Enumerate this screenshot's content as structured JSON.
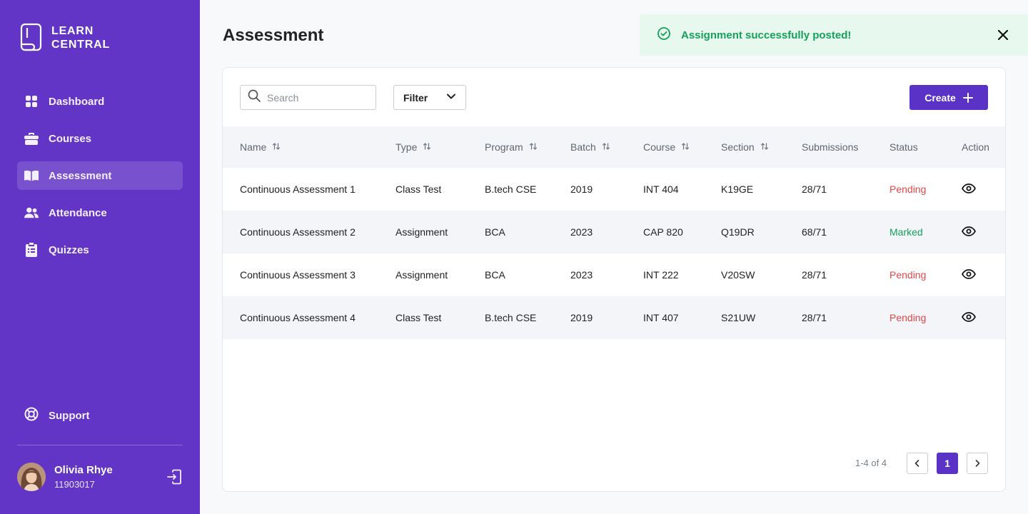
{
  "app": {
    "logo_line1": "LEARN",
    "logo_line2": "CENTRAL"
  },
  "sidebar": {
    "items": [
      {
        "label": "Dashboard",
        "icon": "grid-icon"
      },
      {
        "label": "Courses",
        "icon": "briefcase-icon"
      },
      {
        "label": "Assessment",
        "icon": "book-open-icon",
        "active": true
      },
      {
        "label": "Attendance",
        "icon": "users-icon"
      },
      {
        "label": "Quizzes",
        "icon": "clipboard-icon"
      }
    ],
    "support_label": "Support",
    "user": {
      "name": "Olivia Rhye",
      "id": "11903017"
    }
  },
  "page": {
    "title": "Assessment"
  },
  "toast": {
    "message": "Assignment successfully posted!"
  },
  "toolbar": {
    "search_placeholder": "Search",
    "filter_label": "Filter",
    "create_label": "Create"
  },
  "table": {
    "headers": [
      "Name",
      "Type",
      "Program",
      "Batch",
      "Course",
      "Section",
      "Submissions",
      "Status",
      "Action"
    ],
    "rows": [
      {
        "name": "Continuous Assessment 1",
        "type": "Class Test",
        "program": "B.tech CSE",
        "batch": "2019",
        "course": "INT 404",
        "section": "K19GE",
        "submissions": "28/71",
        "status": "Pending"
      },
      {
        "name": "Continuous Assessment 2",
        "type": "Assignment",
        "program": "BCA",
        "batch": "2023",
        "course": "CAP 820",
        "section": "Q19DR",
        "submissions": "68/71",
        "status": "Marked"
      },
      {
        "name": "Continuous Assessment 3",
        "type": "Assignment",
        "program": "BCA",
        "batch": "2023",
        "course": "INT 222",
        "section": "V20SW",
        "submissions": "28/71",
        "status": "Pending"
      },
      {
        "name": "Continuous Assessment 4",
        "type": "Class Test",
        "program": "B.tech CSE",
        "batch": "2019",
        "course": "INT 407",
        "section": "S21UW",
        "submissions": "28/71",
        "status": "Pending"
      }
    ]
  },
  "pagination": {
    "range": "1-4 of 4",
    "current_page": "1"
  },
  "colors": {
    "sidebar": "#6235C7",
    "primary": "#5A32C6",
    "success": "#16A05A",
    "danger": "#E24747"
  }
}
